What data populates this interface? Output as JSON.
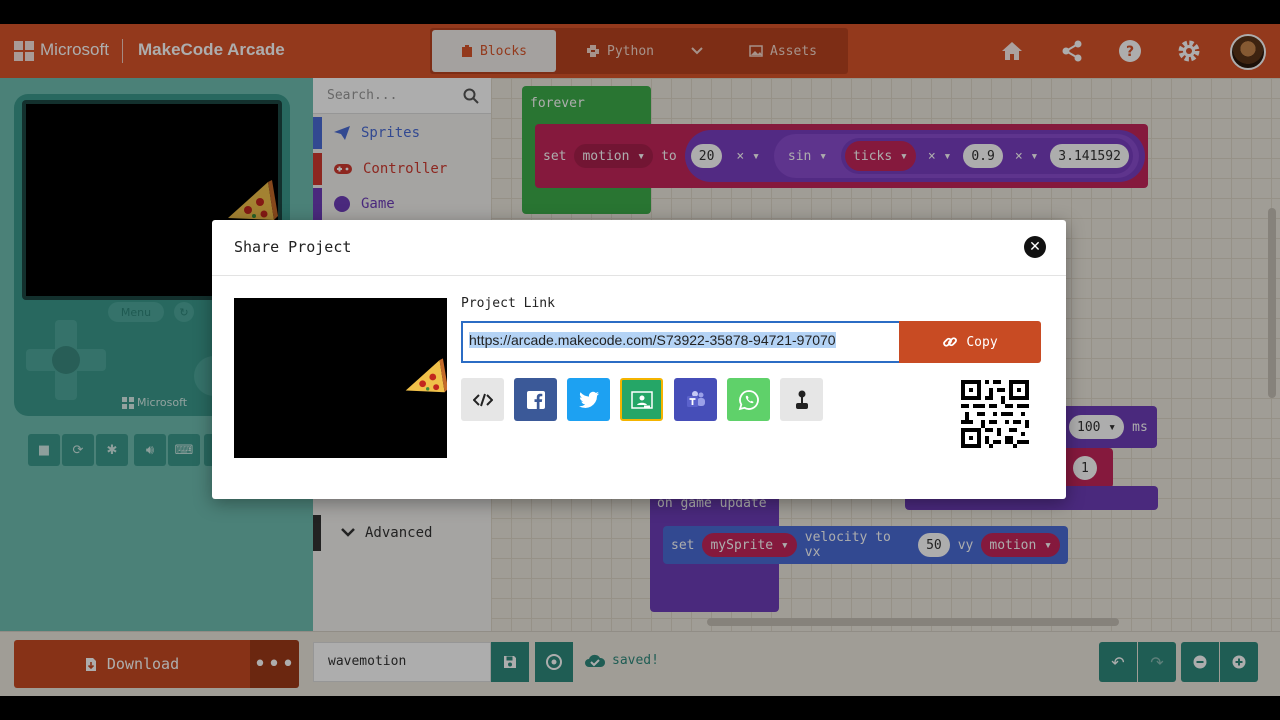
{
  "header": {
    "brand": "Microsoft",
    "app_name": "MakeCode Arcade",
    "tabs": [
      {
        "label": "Blocks",
        "active": true
      },
      {
        "label": "Python",
        "active": false
      },
      {
        "label": "Assets",
        "active": false
      }
    ],
    "icons": [
      "home-icon",
      "share-icon",
      "help-icon",
      "settings-icon",
      "avatar"
    ],
    "accent": "#d9542a"
  },
  "simulator": {
    "menu_label": "Menu",
    "brand": "Microsoft",
    "tools": [
      "stop-icon",
      "restart-icon",
      "debug-icon",
      "volume-icon",
      "keyboard-icon"
    ]
  },
  "toolbox": {
    "search_placeholder": "Search...",
    "categories": [
      {
        "label": "Sprites",
        "color": "#4b6cd6"
      },
      {
        "label": "Controller",
        "color": "#d03a30"
      },
      {
        "label": "Game",
        "color": "#6e3db8"
      }
    ],
    "advanced": "Advanced"
  },
  "workspace": {
    "forever": {
      "hat": "forever",
      "set": "set",
      "var": "motion",
      "to": "to",
      "a": "20",
      "op1": "×",
      "fn": "sin",
      "ticks": "ticks",
      "op2": "×",
      "b": "0.9",
      "op3": "×",
      "c": "3.141592"
    },
    "pause": {
      "value": "100",
      "unit": "ms"
    },
    "one": "1",
    "update": {
      "hat": "on game update",
      "set": "set",
      "sprite": "mySprite",
      "velocity": "velocity to vx",
      "vx": "50",
      "vy_label": "vy",
      "vy": "motion"
    }
  },
  "footer": {
    "download": "Download",
    "project_name": "wavemotion",
    "status": "saved!"
  },
  "modal": {
    "title": "Share Project",
    "link_label": "Project Link",
    "link": "https://arcade.makecode.com/S73922-35878-94721-97070",
    "copy": "Copy",
    "share_targets": [
      "embed-icon",
      "facebook-icon",
      "twitter-icon",
      "google-classroom-icon",
      "teams-icon",
      "whatsapp-icon",
      "device-icon"
    ]
  }
}
